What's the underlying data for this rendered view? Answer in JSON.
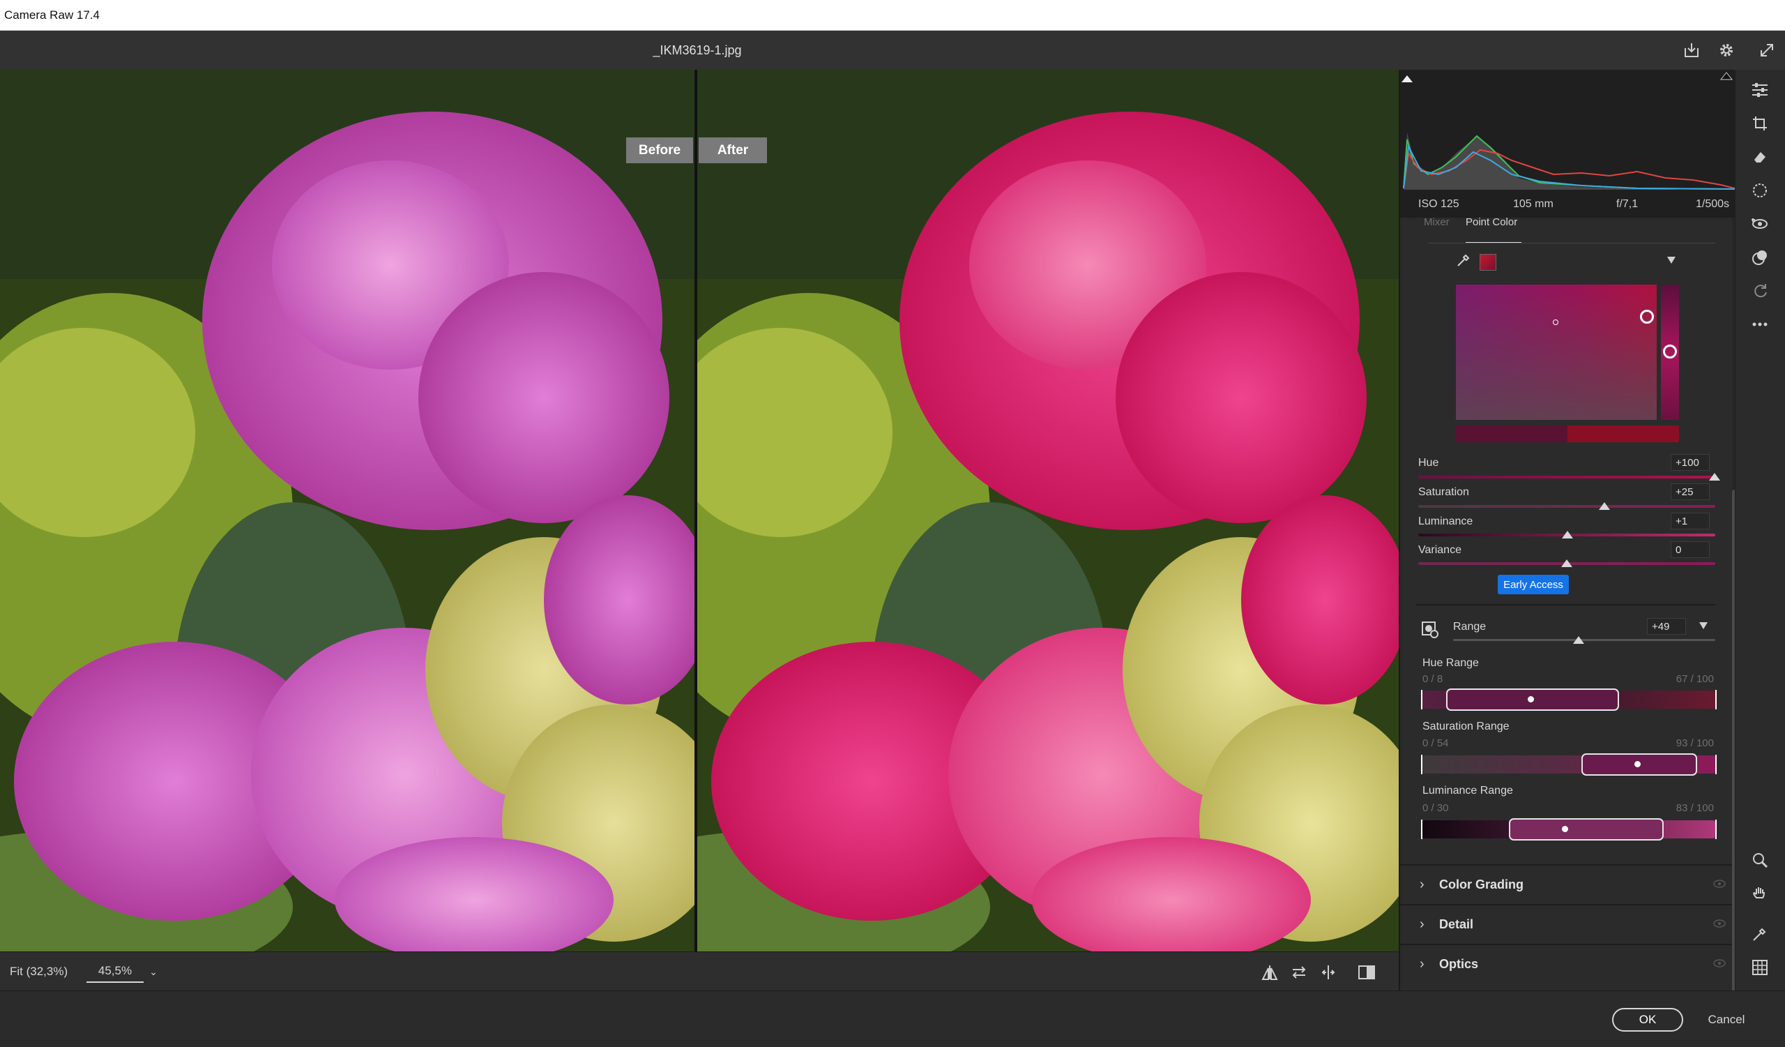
{
  "app": {
    "title": "Camera Raw 17.4"
  },
  "header": {
    "filename": "_IKM3619-1.jpg",
    "icons": [
      "save-icon",
      "gear-icon",
      "fullscreen-icon"
    ]
  },
  "canvas": {
    "before_label": "Before",
    "after_label": "After"
  },
  "bottombar": {
    "fit_label": "Fit (32,3%)",
    "zoom_value": "45,5%"
  },
  "histogram": {
    "iso": "ISO 125",
    "focal": "105 mm",
    "aperture": "f/7,1",
    "shutter": "1/500s"
  },
  "point_color": {
    "tabs": {
      "mixer": "Mixer",
      "point_color": "Point Color"
    },
    "sliders": [
      {
        "label": "Hue",
        "value": "+100"
      },
      {
        "label": "Saturation",
        "value": "+25"
      },
      {
        "label": "Luminance",
        "value": "+1"
      },
      {
        "label": "Variance",
        "value": "0"
      }
    ],
    "early_access": "Early Access",
    "range": {
      "label": "Range",
      "value": "+49"
    },
    "hue_range": {
      "label": "Hue Range",
      "left": "0 / 8",
      "right": "67 / 100"
    },
    "saturation_range": {
      "label": "Saturation Range",
      "left": "0 / 54",
      "right": "93 / 100"
    },
    "luminance_range": {
      "label": "Luminance Range",
      "left": "0 / 30",
      "right": "83 / 100"
    }
  },
  "sections": [
    "Color Grading",
    "Detail",
    "Optics"
  ],
  "footer": {
    "ok": "OK",
    "cancel": "Cancel"
  },
  "colors": {
    "accent": "#1473e6",
    "panel": "#2b2b2b",
    "magenta": "#8e1a5a"
  }
}
